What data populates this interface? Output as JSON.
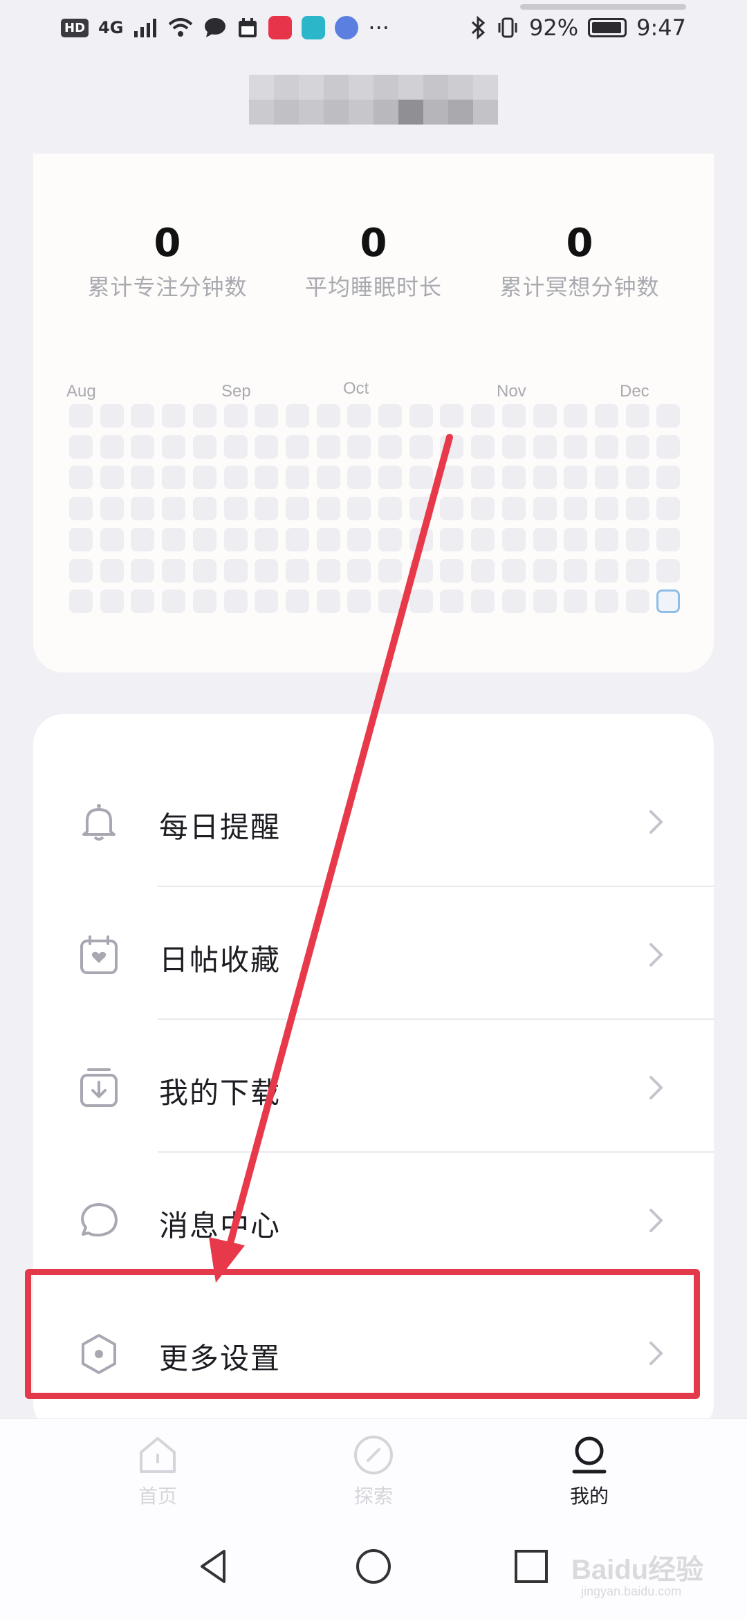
{
  "status_bar": {
    "hd": "HD",
    "network": "4G",
    "battery_percent": "92%",
    "time": "9:47",
    "more": "···"
  },
  "stats": [
    {
      "value": "0",
      "label": "累计专注分钟数"
    },
    {
      "value": "0",
      "label": "平均睡眠时长"
    },
    {
      "value": "0",
      "label": "累计冥想分钟数"
    }
  ],
  "heatmap": {
    "months": [
      "Aug",
      "Sep",
      "Oct",
      "Nov",
      "Dec"
    ],
    "columns": 20,
    "rows": 7,
    "today_column": 19,
    "today_row": 6
  },
  "menu": [
    {
      "label": "每日提醒",
      "icon": "bell-icon"
    },
    {
      "label": "日帖收藏",
      "icon": "calendar-heart-icon"
    },
    {
      "label": "我的下载",
      "icon": "download-icon"
    },
    {
      "label": "消息中心",
      "icon": "chat-bubble-icon"
    },
    {
      "label": "更多设置",
      "icon": "settings-hexagon-icon"
    }
  ],
  "tabs": [
    {
      "label": "首页",
      "icon": "home-icon",
      "active": false
    },
    {
      "label": "探索",
      "icon": "compass-icon",
      "active": false
    },
    {
      "label": "我的",
      "icon": "profile-icon",
      "active": true
    }
  ],
  "watermark": {
    "text": "Baidu经验",
    "sub": "jingyan.baidu.com"
  },
  "colors": {
    "highlight": "#e23a4a",
    "arrow": "#e8394a",
    "today_cell": "#8fbde6"
  }
}
